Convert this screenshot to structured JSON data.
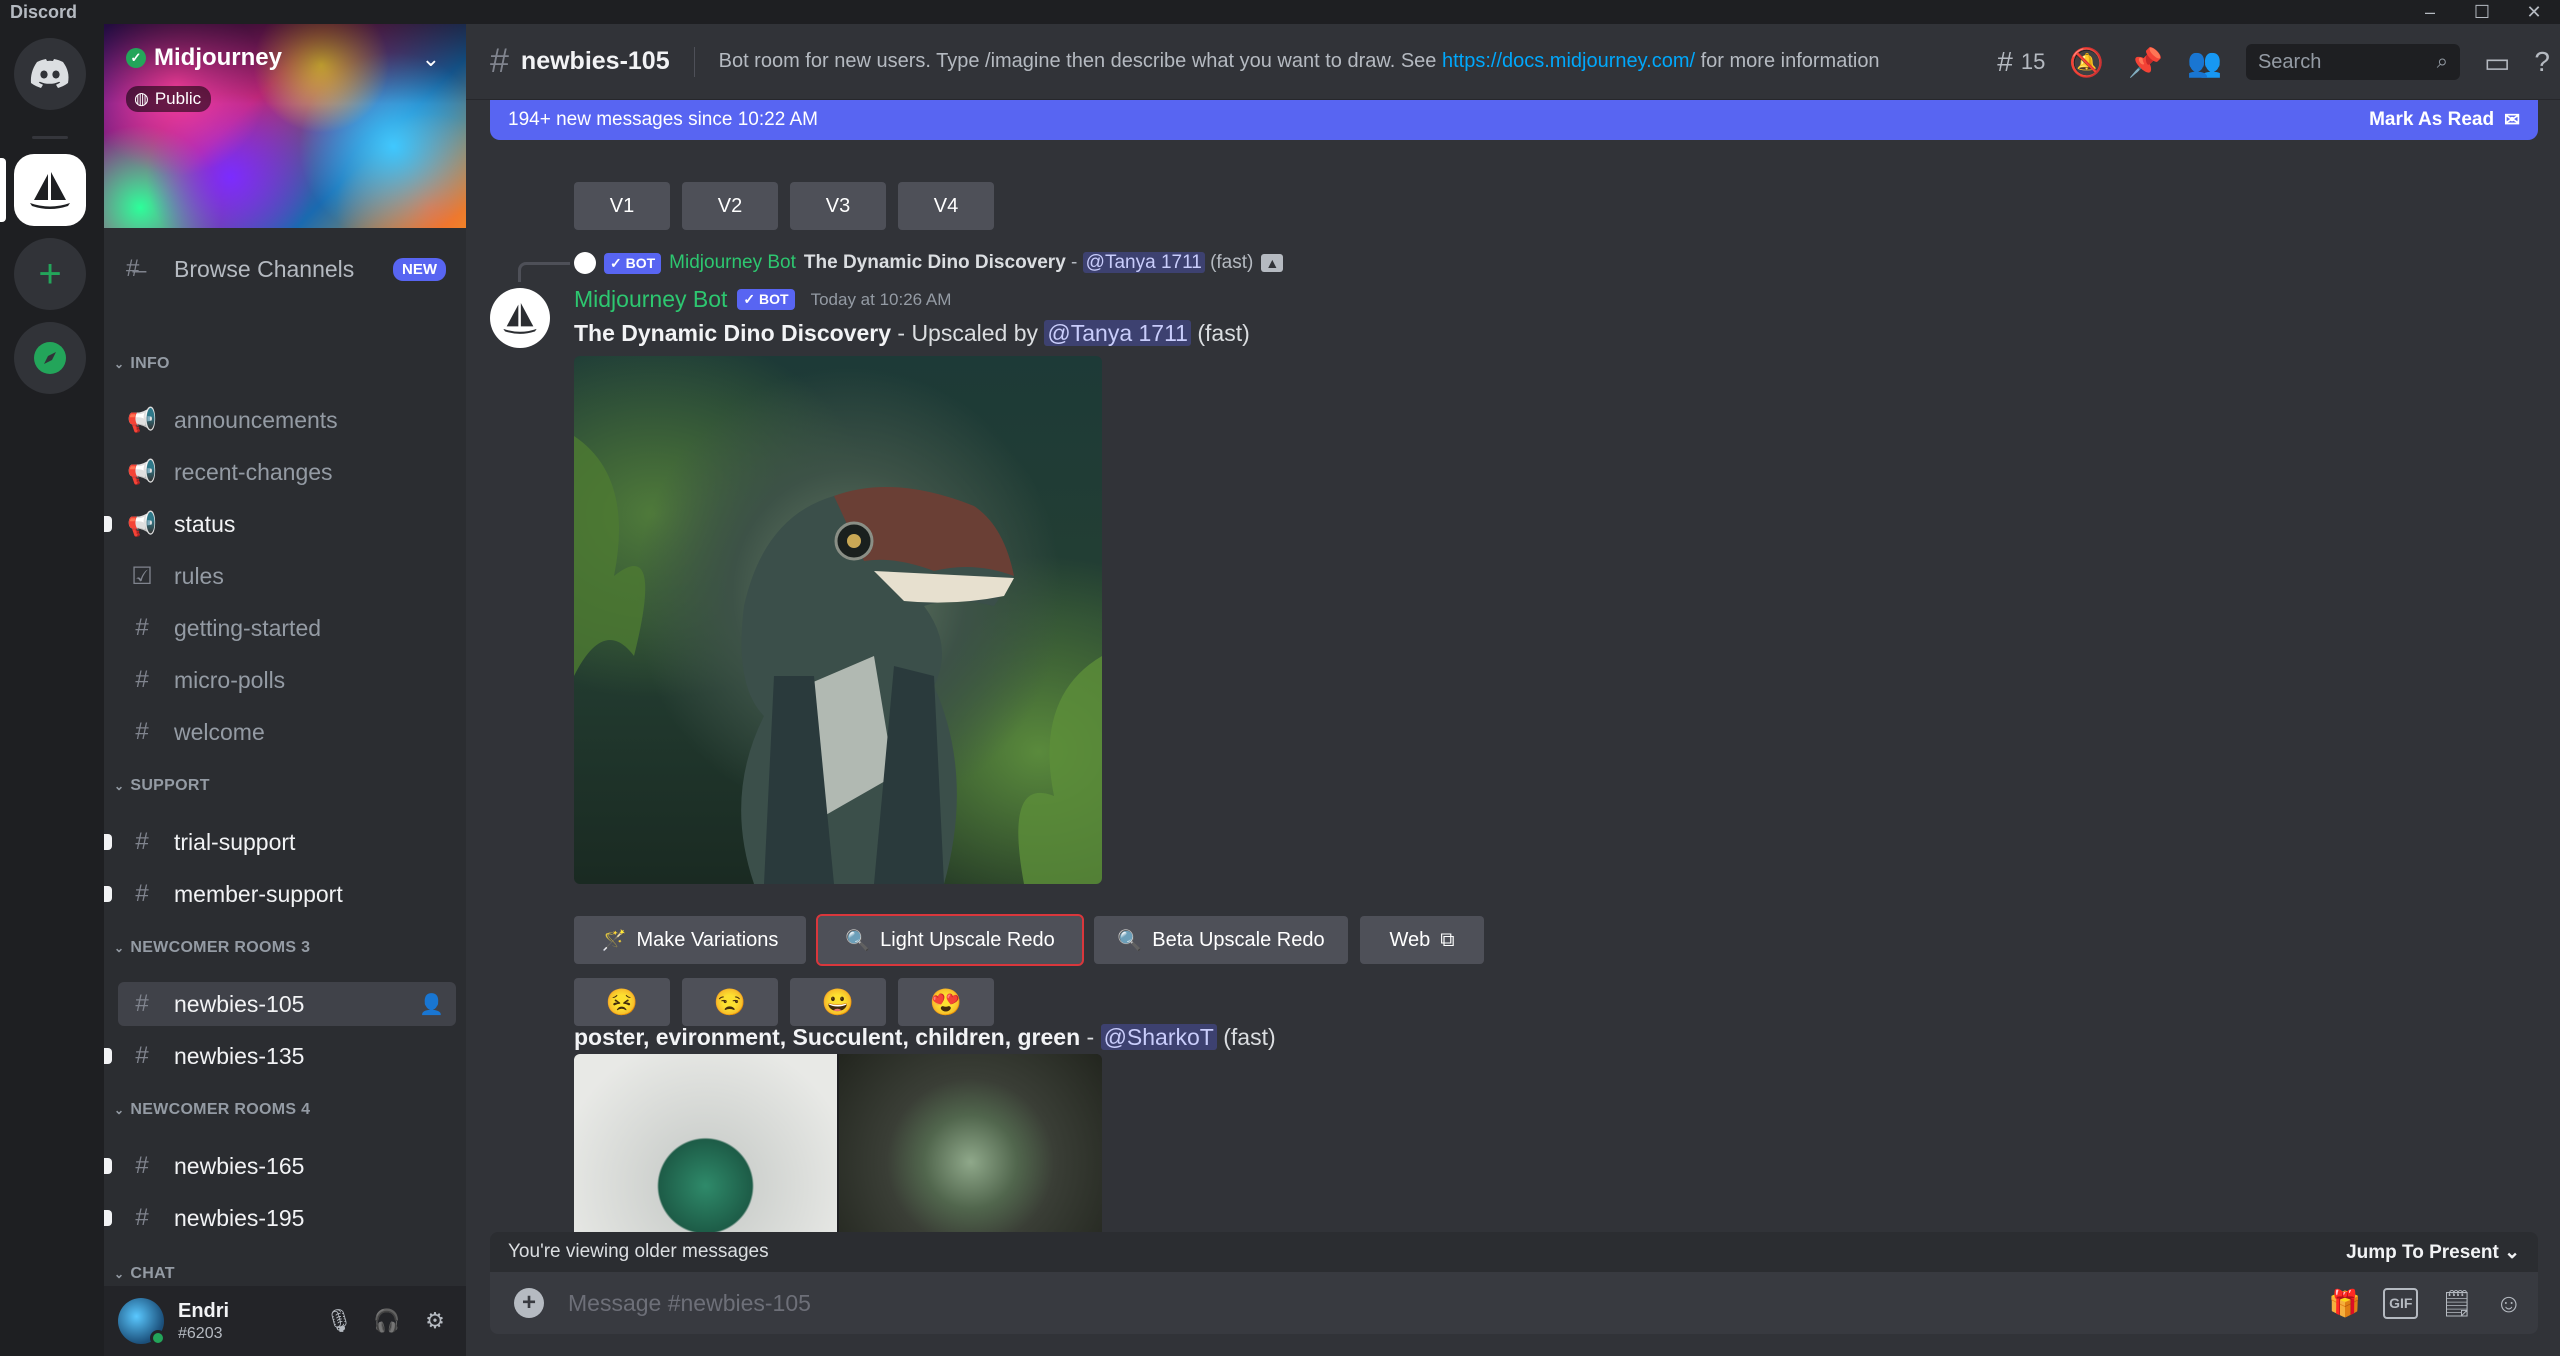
{
  "window": {
    "title": "Discord",
    "controls": [
      "–",
      "☐",
      "✕"
    ]
  },
  "server": {
    "name": "Midjourney",
    "visibility": "Public"
  },
  "sidebar": {
    "browse": {
      "label": "Browse Channels",
      "badge": "NEW"
    },
    "categories": {
      "info": "INFO",
      "support": "SUPPORT",
      "newcomer3": "NEWCOMER ROOMS 3",
      "newcomer4": "NEWCOMER ROOMS 4",
      "chat": "CHAT"
    },
    "info_channels": [
      "announcements",
      "recent-changes",
      "status",
      "rules",
      "getting-started",
      "micro-polls",
      "welcome"
    ],
    "support_channels": [
      "trial-support",
      "member-support"
    ],
    "newcomer3_channels": [
      "newbies-105",
      "newbies-135"
    ],
    "newcomer4_channels": [
      "newbies-165",
      "newbies-195"
    ]
  },
  "user": {
    "name": "Endri",
    "tag": "#6203"
  },
  "header": {
    "channel": "newbies-105",
    "topic_prefix": "Bot room for new users. Type /imagine then describe what you want to draw. See ",
    "topic_link": "https://docs.midjourney.com/",
    "topic_suffix": " for more information",
    "threads_count": "15",
    "search_placeholder": "Search"
  },
  "banner": {
    "text": "194+ new messages since 10:22 AM",
    "mark_read": "Mark As Read"
  },
  "variation_buttons": [
    "V1",
    "V2",
    "V3",
    "V4"
  ],
  "reply": {
    "bot_tag": "✓ BOT",
    "author": "Midjourney Bot",
    "title": "The Dynamic Dino Discovery",
    "sep": " - ",
    "mention": "@Tanya 1711",
    "mode": "(fast)"
  },
  "message": {
    "author": "Midjourney Bot",
    "bot_tag": "✓ BOT",
    "timestamp": "Today at 10:26 AM",
    "title": "The Dynamic Dino Discovery",
    "upscaled_by": " - Upscaled by ",
    "mention": "@Tanya 1711",
    "mode": "(fast)"
  },
  "actions": {
    "make_variations": "Make Variations",
    "light_upscale": "Light Upscale Redo",
    "beta_upscale": "Beta Upscale Redo",
    "web": "Web"
  },
  "reactions": [
    "😣",
    "😒",
    "😀",
    "😍"
  ],
  "prompt2": {
    "text": "poster, evironment, Succulent, children, green",
    "sep": " - ",
    "mention": "@SharkoT",
    "mode": "(fast)"
  },
  "older": {
    "text": "You're viewing older messages",
    "jump": "Jump To Present"
  },
  "composer": {
    "placeholder": "Message #newbies-105"
  }
}
